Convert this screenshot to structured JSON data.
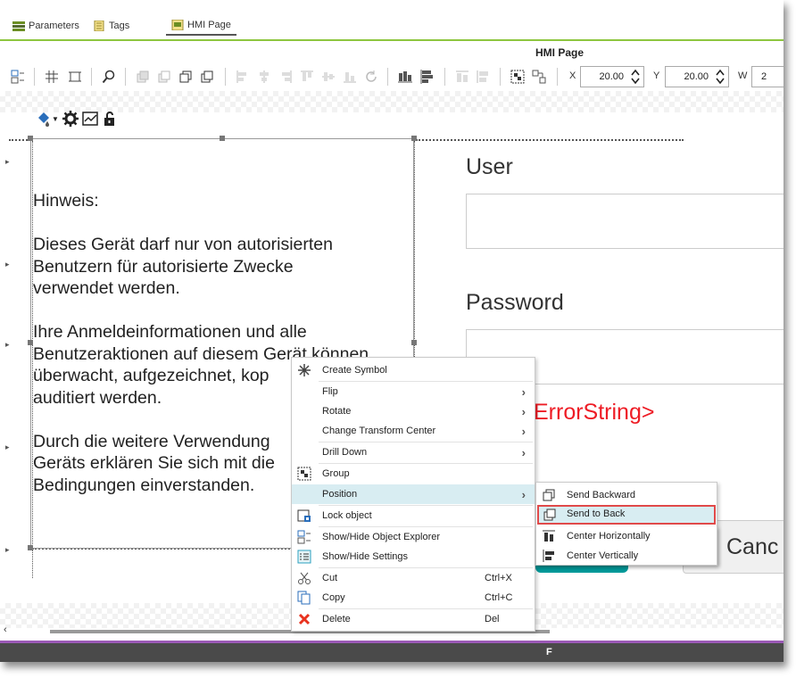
{
  "tabs": [
    {
      "label": "Parameters",
      "icon": "parameters-icon"
    },
    {
      "label": "Tags",
      "icon": "tags-icon"
    },
    {
      "label": "HMI Page",
      "icon": "hmi-page-icon",
      "active": true
    }
  ],
  "page_title": "HMI Page",
  "toolbar": {
    "x_label": "X",
    "x_value": "20.00",
    "y_label": "Y",
    "y_value": "20.00",
    "w_label": "W",
    "w_value": "2"
  },
  "notice": {
    "heading": "Hinweis:",
    "paragraphs": [
      "Dieses Gerät darf nur von autorisierten\nBenutzern für autorisierte Zwecke\nverwendet werden.",
      "Ihre Anmeldeinformationen und alle\nBenutzeraktionen auf diesem Gerät können\nüberwacht, aufgezeichnet, kop\nauditiert werden.",
      "Durch die weitere Verwendung\nGeräts erklären Sie sich mit die\nBedingungen einverstanden."
    ]
  },
  "form": {
    "user_label": "User",
    "password_label": "Password",
    "error_string": "ErrorString>",
    "cancel_label": "Canc"
  },
  "context_menu": {
    "items": [
      {
        "label": "Create Symbol",
        "icon": "create-symbol-icon",
        "submenu": false,
        "shortcut": ""
      },
      {
        "label": "Flip",
        "icon": "",
        "submenu": true,
        "shortcut": ""
      },
      {
        "label": "Rotate",
        "icon": "",
        "submenu": true,
        "shortcut": ""
      },
      {
        "label": "Change Transform Center",
        "icon": "",
        "submenu": true,
        "shortcut": ""
      },
      {
        "label": "Drill Down",
        "icon": "",
        "submenu": true,
        "shortcut": ""
      },
      {
        "label": "Group",
        "icon": "group-icon",
        "submenu": false,
        "shortcut": ""
      },
      {
        "label": "Position",
        "icon": "",
        "submenu": true,
        "shortcut": "",
        "highlighted": true
      },
      {
        "label": "Lock object",
        "icon": "lock-object-icon",
        "submenu": false,
        "shortcut": ""
      },
      {
        "label": "Show/Hide Object Explorer",
        "icon": "object-explorer-icon",
        "submenu": false,
        "shortcut": ""
      },
      {
        "label": "Show/Hide Settings",
        "icon": "settings-panel-icon",
        "submenu": false,
        "shortcut": ""
      },
      {
        "label": "Cut",
        "icon": "scissors-icon",
        "submenu": false,
        "shortcut": "Ctrl+X"
      },
      {
        "label": "Copy",
        "icon": "copy-icon",
        "submenu": false,
        "shortcut": "Ctrl+C"
      },
      {
        "label": "Delete",
        "icon": "delete-x-icon",
        "submenu": false,
        "shortcut": "Del"
      }
    ]
  },
  "position_submenu": {
    "items": [
      {
        "label": "Send Backward",
        "icon": "send-backward-icon"
      },
      {
        "label": "Send to Back",
        "icon": "send-to-back-icon",
        "highlighted": true
      },
      {
        "label": "Center Horizontally",
        "icon": "center-horizontally-icon"
      },
      {
        "label": "Center Vertically",
        "icon": "center-vertically-icon"
      }
    ]
  },
  "status_bar": {
    "text": "F"
  },
  "colors": {
    "accent_green": "#8dc63f",
    "error_red": "#ee1c25",
    "menu_highlight": "#d8edf2",
    "callout_red": "#e04a4a",
    "teal_button": "#009999",
    "purple_bar": "#9b59b6"
  }
}
